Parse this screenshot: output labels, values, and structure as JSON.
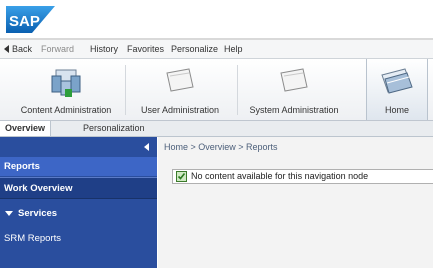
{
  "app": {
    "logo_text": "SAP"
  },
  "menubar": {
    "back": "Back",
    "forward": "Forward",
    "items": [
      "History",
      "Favorites",
      "Personalize",
      "Help"
    ]
  },
  "topnav": {
    "items": [
      {
        "label": "Content Administration",
        "icon": "content-admin-icon"
      },
      {
        "label": "User Administration",
        "icon": "folder-icon"
      },
      {
        "label": "System Administration",
        "icon": "folder-icon"
      },
      {
        "label": "Home",
        "icon": "home-folder-icon",
        "active": true
      }
    ]
  },
  "tabs": [
    {
      "label": "Overview",
      "active": true
    },
    {
      "label": "Personalization",
      "active": false
    }
  ],
  "leftnav": {
    "items": [
      {
        "label": "Reports",
        "selected": true
      },
      {
        "label": "Work Overview"
      },
      {
        "label": "Services",
        "expanded": true
      },
      {
        "label": "SRM Reports"
      }
    ]
  },
  "content": {
    "breadcrumb": "Home  >  Overview  >  Reports",
    "message": "No content available for this navigation node"
  },
  "colors": {
    "leftnav_bg": "#2a4e9e",
    "leftnav_selected": "#3d66c6",
    "sap_blue": "#0a6ec1"
  }
}
